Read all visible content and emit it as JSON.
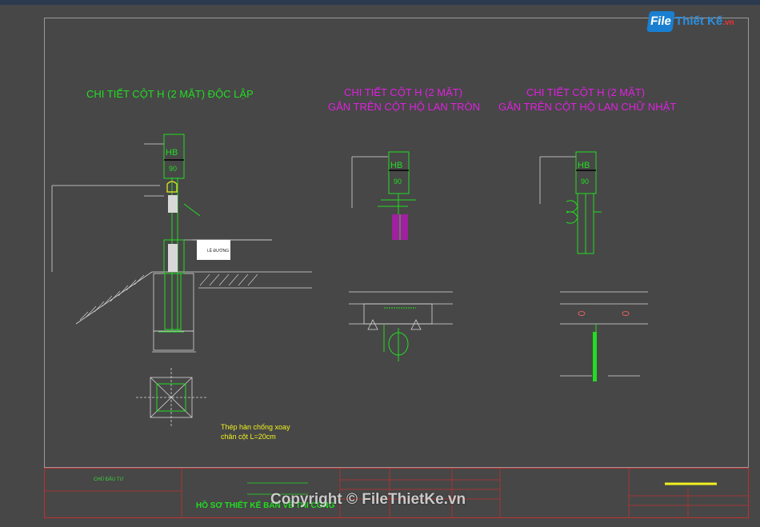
{
  "logo": {
    "file": "File",
    "name": "Thiết Kế",
    "suffix": ".vn"
  },
  "headings": {
    "standalone": "CHI TIẾT CỘT H (2 MẶT) ĐỘC LẬP",
    "round_line1": "CHI TIẾT CỘT H (2 MẶT)",
    "round_line2": "GẮN TRÊN CỘT HỘ LAN TRÒN",
    "rect_line1": "CHI TIẾT CỘT H (2 MẶT)",
    "rect_line2": "GẮN TRÊN CỘT HỘ LAN CHỮ NHẬT"
  },
  "sign": {
    "letters": "HB",
    "number": "90"
  },
  "notes": {
    "label_le_duong": "LỀ ĐƯỜNG",
    "anchor_note_line1": "Thép hàn chống xoay",
    "anchor_note_line2": "chân cột L=20cm"
  },
  "title_block": {
    "chu_dau_tu": "CHỦ ĐẦU TƯ",
    "project_title": "HỒ SƠ THIẾT KẾ BẢN VẼ THI CÔNG"
  },
  "watermark": "Copyright © FileThietKe.vn",
  "colors": {
    "background": "#474747",
    "line_green": "#22dd22",
    "magenta": "#e020e0",
    "yellow": "#f0f020",
    "frame_red": "#c03030"
  }
}
